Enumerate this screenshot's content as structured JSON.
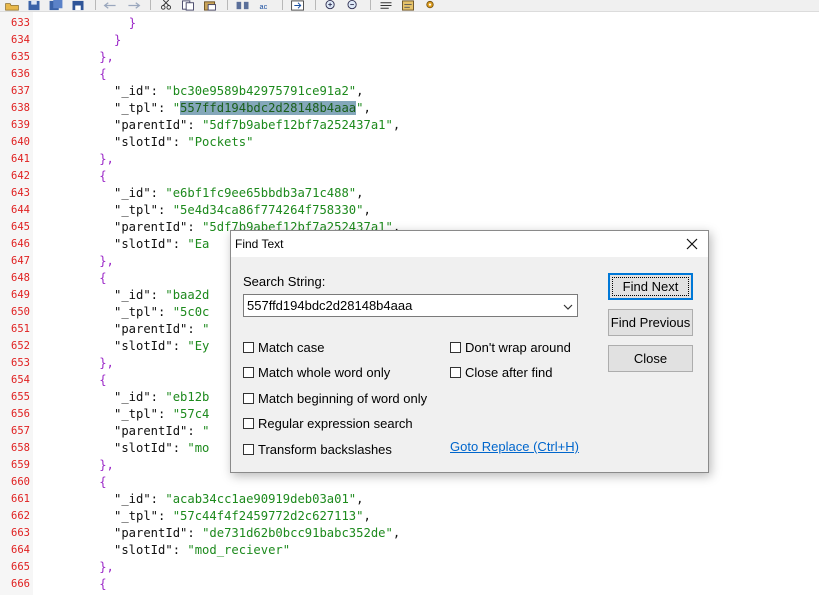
{
  "toolbar": {
    "icons": [
      "open-folder-icon",
      "save-icon",
      "save-all-icon",
      "save-copy-icon",
      "undo-icon",
      "redo-icon",
      "cut-icon",
      "copy-icon",
      "paste-icon",
      "find-icon",
      "replace-icon",
      "goto-icon",
      "zoom-in-icon",
      "zoom-out-icon",
      "word-wrap-icon",
      "file-properties-icon",
      "settings-icon"
    ]
  },
  "editor": {
    "lines": [
      {
        "n": "633",
        "indent": 12,
        "parts": [
          {
            "t": "}",
            "c": "p"
          }
        ]
      },
      {
        "n": "634",
        "indent": 10,
        "parts": [
          {
            "t": "}",
            "c": "p"
          }
        ]
      },
      {
        "n": "635",
        "indent": 8,
        "parts": [
          {
            "t": "},",
            "c": "p"
          }
        ]
      },
      {
        "n": "636",
        "indent": 8,
        "parts": [
          {
            "t": "{",
            "c": "p"
          }
        ]
      },
      {
        "n": "637",
        "indent": 10,
        "parts": [
          {
            "t": "\"_id\": ",
            "c": "k"
          },
          {
            "t": "\"bc30e9589b42975791ce91a2\"",
            "c": "s"
          },
          {
            "t": ",",
            "c": "k"
          }
        ]
      },
      {
        "n": "638",
        "indent": 10,
        "parts": [
          {
            "t": "\"_tpl\": ",
            "c": "k"
          },
          {
            "t": "\"",
            "c": "s"
          },
          {
            "t": "557ffd194bdc2d28148b4aaa",
            "c": "hl"
          },
          {
            "t": "\"",
            "c": "s"
          },
          {
            "t": ",",
            "c": "k"
          }
        ]
      },
      {
        "n": "639",
        "indent": 10,
        "parts": [
          {
            "t": "\"parentId\": ",
            "c": "k"
          },
          {
            "t": "\"5df7b9abef12bf7a252437a1\"",
            "c": "s"
          },
          {
            "t": ",",
            "c": "k"
          }
        ]
      },
      {
        "n": "640",
        "indent": 10,
        "parts": [
          {
            "t": "\"slotId\": ",
            "c": "k"
          },
          {
            "t": "\"Pockets\"",
            "c": "s"
          }
        ]
      },
      {
        "n": "641",
        "indent": 8,
        "parts": [
          {
            "t": "},",
            "c": "p"
          }
        ]
      },
      {
        "n": "642",
        "indent": 8,
        "parts": [
          {
            "t": "{",
            "c": "p"
          }
        ]
      },
      {
        "n": "643",
        "indent": 10,
        "parts": [
          {
            "t": "\"_id\": ",
            "c": "k"
          },
          {
            "t": "\"e6bf1fc9ee65bbdb3a71c488\"",
            "c": "s"
          },
          {
            "t": ",",
            "c": "k"
          }
        ]
      },
      {
        "n": "644",
        "indent": 10,
        "parts": [
          {
            "t": "\"_tpl\": ",
            "c": "k"
          },
          {
            "t": "\"5e4d34ca86f774264f758330\"",
            "c": "s"
          },
          {
            "t": ",",
            "c": "k"
          }
        ]
      },
      {
        "n": "645",
        "indent": 10,
        "parts": [
          {
            "t": "\"parentId\": ",
            "c": "k"
          },
          {
            "t": "\"5df7b9abef12bf7a252437a1\"",
            "c": "s"
          },
          {
            "t": ",",
            "c": "k"
          }
        ]
      },
      {
        "n": "646",
        "indent": 10,
        "parts": [
          {
            "t": "\"slotId\": ",
            "c": "k"
          },
          {
            "t": "\"Ea",
            "c": "s"
          }
        ]
      },
      {
        "n": "647",
        "indent": 8,
        "parts": [
          {
            "t": "},",
            "c": "p"
          }
        ]
      },
      {
        "n": "648",
        "indent": 8,
        "parts": [
          {
            "t": "{",
            "c": "p"
          }
        ]
      },
      {
        "n": "649",
        "indent": 10,
        "parts": [
          {
            "t": "\"_id\": ",
            "c": "k"
          },
          {
            "t": "\"baa2d",
            "c": "s"
          }
        ]
      },
      {
        "n": "650",
        "indent": 10,
        "parts": [
          {
            "t": "\"_tpl\": ",
            "c": "k"
          },
          {
            "t": "\"5c0c",
            "c": "s"
          }
        ]
      },
      {
        "n": "651",
        "indent": 10,
        "parts": [
          {
            "t": "\"parentId\": ",
            "c": "k"
          },
          {
            "t": "\"",
            "c": "s"
          }
        ]
      },
      {
        "n": "652",
        "indent": 10,
        "parts": [
          {
            "t": "\"slotId\": ",
            "c": "k"
          },
          {
            "t": "\"Ey",
            "c": "s"
          }
        ]
      },
      {
        "n": "653",
        "indent": 8,
        "parts": [
          {
            "t": "},",
            "c": "p"
          }
        ]
      },
      {
        "n": "654",
        "indent": 8,
        "parts": [
          {
            "t": "{",
            "c": "p"
          }
        ]
      },
      {
        "n": "655",
        "indent": 10,
        "parts": [
          {
            "t": "\"_id\": ",
            "c": "k"
          },
          {
            "t": "\"eb12b",
            "c": "s"
          }
        ]
      },
      {
        "n": "656",
        "indent": 10,
        "parts": [
          {
            "t": "\"_tpl\": ",
            "c": "k"
          },
          {
            "t": "\"57c4",
            "c": "s"
          }
        ]
      },
      {
        "n": "657",
        "indent": 10,
        "parts": [
          {
            "t": "\"parentId\": ",
            "c": "k"
          },
          {
            "t": "\"",
            "c": "s"
          }
        ]
      },
      {
        "n": "658",
        "indent": 10,
        "parts": [
          {
            "t": "\"slotId\": ",
            "c": "k"
          },
          {
            "t": "\"mo",
            "c": "s"
          }
        ]
      },
      {
        "n": "659",
        "indent": 8,
        "parts": [
          {
            "t": "},",
            "c": "p"
          }
        ]
      },
      {
        "n": "660",
        "indent": 8,
        "parts": [
          {
            "t": "{",
            "c": "p"
          }
        ]
      },
      {
        "n": "661",
        "indent": 10,
        "parts": [
          {
            "t": "\"_id\": ",
            "c": "k"
          },
          {
            "t": "\"acab34cc1ae90919deb03a01\"",
            "c": "s"
          },
          {
            "t": ",",
            "c": "k"
          }
        ]
      },
      {
        "n": "662",
        "indent": 10,
        "parts": [
          {
            "t": "\"_tpl\": ",
            "c": "k"
          },
          {
            "t": "\"57c44f4f2459772d2c627113\"",
            "c": "s"
          },
          {
            "t": ",",
            "c": "k"
          }
        ]
      },
      {
        "n": "663",
        "indent": 10,
        "parts": [
          {
            "t": "\"parentId\": ",
            "c": "k"
          },
          {
            "t": "\"de731d62b0bcc91babc352de\"",
            "c": "s"
          },
          {
            "t": ",",
            "c": "k"
          }
        ]
      },
      {
        "n": "664",
        "indent": 10,
        "parts": [
          {
            "t": "\"slotId\": ",
            "c": "k"
          },
          {
            "t": "\"mod_reciever\"",
            "c": "s"
          }
        ]
      },
      {
        "n": "665",
        "indent": 8,
        "parts": [
          {
            "t": "},",
            "c": "p"
          }
        ]
      },
      {
        "n": "666",
        "indent": 8,
        "parts": [
          {
            "t": "{",
            "c": "p"
          }
        ]
      }
    ]
  },
  "find_dialog": {
    "title": "Find Text",
    "search_label": "Search String:",
    "search_value": "557ffd194bdc2d28148b4aaa",
    "options_left": [
      {
        "label": "Match case",
        "checked": false
      },
      {
        "label": "Match whole word only",
        "checked": false
      },
      {
        "label": "Match beginning of word only",
        "checked": false
      },
      {
        "label": "Regular expression search",
        "checked": false
      },
      {
        "label": "Transform backslashes",
        "checked": false
      }
    ],
    "options_right": [
      {
        "label": "Don't wrap around",
        "checked": false
      },
      {
        "label": "Close after find",
        "checked": false
      }
    ],
    "buttons": {
      "find_next": "Find Next",
      "find_previous": "Find Previous",
      "close": "Close"
    },
    "goto_replace": "Goto Replace (Ctrl+H)"
  }
}
